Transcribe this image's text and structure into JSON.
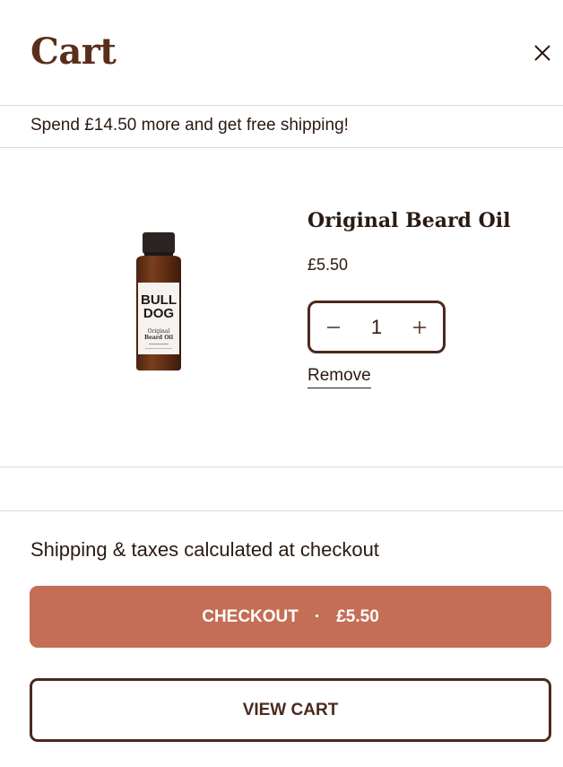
{
  "header": {
    "title": "Cart",
    "close_icon": "close-icon"
  },
  "shipping_banner": "Spend £14.50 more and get free shipping!",
  "item": {
    "name": "Original Beard Oil",
    "price": "£5.50",
    "quantity": "1",
    "remove_label": "Remove",
    "image": {
      "brand_line1": "BULL",
      "brand_line2": "DOG",
      "product_line1": "Original",
      "product_line2": "Beard Oil"
    }
  },
  "footer": {
    "tax_note": "Shipping & taxes calculated at checkout",
    "checkout_label": "CHECKOUT",
    "checkout_separator": "·",
    "checkout_total": "£5.50",
    "view_cart_label": "VIEW CART"
  },
  "colors": {
    "accent": "#c46e55",
    "brand_brown": "#5a2e1b",
    "border_brown": "#4a2a1c",
    "text": "#2b1a12",
    "divider": "#dedad8"
  }
}
